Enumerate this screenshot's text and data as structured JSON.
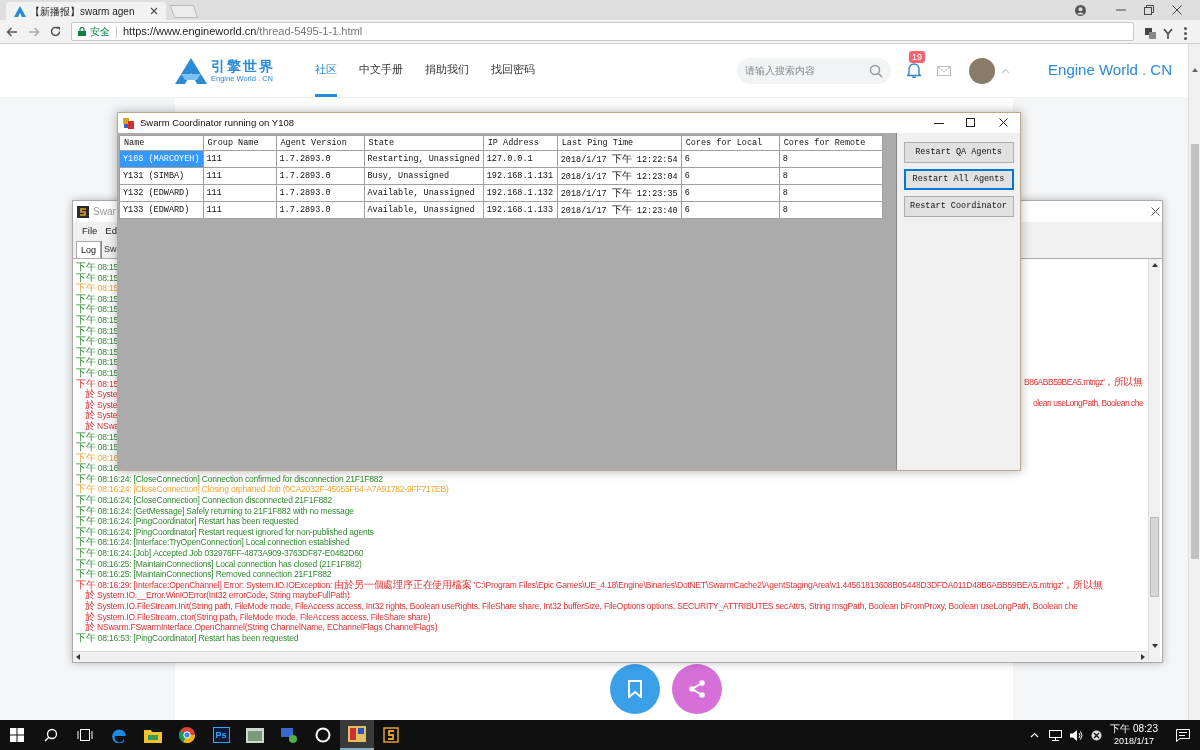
{
  "browser": {
    "tab_title": "【新播报】swarm agen",
    "secure_label": "安全",
    "url_host": "https://www.engineworld.cn",
    "url_path": "/thread-5495-1-1.html"
  },
  "site": {
    "logo_text": "引擎世界",
    "logo_subtitle": "Engine World . CN",
    "nav": [
      {
        "label": "社区",
        "selected": true
      },
      {
        "label": "中文手册",
        "selected": false
      },
      {
        "label": "捐助我们",
        "selected": false
      },
      {
        "label": "找回密码",
        "selected": false
      }
    ],
    "search_placeholder": "请输入搜索内容",
    "notification_count": "19",
    "brand": "Engine World . CN"
  },
  "agent_window": {
    "title": "Swar",
    "menu": [
      "File",
      "Ed"
    ],
    "tabs": [
      {
        "label": "Log",
        "selected": true
      },
      {
        "label": "Sw",
        "selected": false
      }
    ],
    "log": [
      {
        "kind": "info",
        "text": "下午 08:15"
      },
      {
        "kind": "info",
        "text": "下午 08:15"
      },
      {
        "kind": "warn",
        "text": "下午 08:15"
      },
      {
        "kind": "info",
        "text": "下午 08:15"
      },
      {
        "kind": "info",
        "text": "下午 08:15"
      },
      {
        "kind": "info",
        "text": "下午 08:15"
      },
      {
        "kind": "info",
        "text": "下午 08:15"
      },
      {
        "kind": "info",
        "text": "下午 08:15"
      },
      {
        "kind": "info",
        "text": "下午 08:15"
      },
      {
        "kind": "info",
        "text": "下午 08:15"
      },
      {
        "kind": "info",
        "text": "下午 08:15"
      },
      {
        "kind": "error",
        "text": "下午 08:15",
        "tail": "B86ABB59BEA5.mtrigz'，所以無"
      },
      {
        "kind": "stack",
        "text": "於 Syste"
      },
      {
        "kind": "stack",
        "text": "於 Syste",
        "tail": "olean useLongPath, Boolean che"
      },
      {
        "kind": "stack",
        "text": "於 Syste"
      },
      {
        "kind": "stack",
        "text": "於 NSwa"
      },
      {
        "kind": "info",
        "text": "下午 08:15"
      },
      {
        "kind": "info",
        "text": "下午 08:15"
      },
      {
        "kind": "warn",
        "text": "下午 08:16"
      },
      {
        "kind": "info",
        "text": "下午 08:16"
      },
      {
        "kind": "info",
        "text": "下午 08:16:24: [CloseConnection] Connection confirmed for disconnection 21F1F882"
      },
      {
        "kind": "warn",
        "text": "下午 08:16:24: [CloseConnection] Closing orphaned Job (0CA2032F-45055F64-A7A91782-9FF717EB)"
      },
      {
        "kind": "info",
        "text": "下午 08:16:24: [CloseConnection] Connection disconnected 21F1F882"
      },
      {
        "kind": "info",
        "text": "下午 08:16:24: [GetMessage] Safely returning to 21F1F882 with no message"
      },
      {
        "kind": "info",
        "text": "下午 08:16:24: [PingCoordinator] Restart has been requested"
      },
      {
        "kind": "info",
        "text": "下午 08:16:24: [PingCoordinator] Restart request ignored for non-published agents"
      },
      {
        "kind": "info",
        "text": "下午 08:16:24: [Interface:TryOpenConnection] Local connection established"
      },
      {
        "kind": "info",
        "text": "下午 08:16:24: [Job] Accepted Job 032976FF-4873A909-3763DF87-E0482D60"
      },
      {
        "kind": "info",
        "text": "下午 08:16:25: [MaintainConnections] Local connection has closed (21F1F882)"
      },
      {
        "kind": "info",
        "text": "下午 08:16:25: [MaintainConnections] Removed connection 21F1F882"
      },
      {
        "kind": "error",
        "text": "下午 08:16:29: [Interface:OpenChannel] Error: System.IO.IOException: 由於另一個處理序正在使用檔案 'C:\\Program Files\\Epic Games\\UE_4.18\\Engine\\Binaries\\DotNET\\SwarmCache2\\AgentStagingArea\\v1.44561813608B05448D3DFDA011D48B6ABB59BEA5.mtrigz'，所以無"
      },
      {
        "kind": "stack",
        "text": "於 System.IO.__Error.WinIOError(Int32 errorCode, String maybeFullPath)"
      },
      {
        "kind": "stack",
        "text": "於 System.IO.FileStream.Init(String path, FileMode mode, FileAccess access, Int32 rights, Boolean useRights, FileShare share, Int32 bufferSize, FileOptions options, SECURITY_ATTRIBUTES secAttrs, String msgPath, Boolean bFromProxy, Boolean useLongPath, Boolean che"
      },
      {
        "kind": "stack",
        "text": "於 System.IO.FileStream..ctor(String path, FileMode mode, FileAccess access, FileShare share)"
      },
      {
        "kind": "stack",
        "text": "於 NSwarm.FSwarmInterface.OpenChannel(String ChannelName, EChannelFlags ChannelFlags)"
      },
      {
        "kind": "info",
        "text": "下午 08:16:53: [PingCoordinator] Restart has been requested"
      }
    ]
  },
  "coordinator": {
    "title": "Swarm Coordinator running on Y108",
    "columns": [
      "Name",
      "Group Name",
      "Agent Version",
      "State",
      "IP Address",
      "Last Ping Time",
      "Cores for Local",
      "Cores for Remote"
    ],
    "rows": [
      {
        "selected": true,
        "cells": [
          "Y108 (MARCOYEH)",
          "111",
          "1.7.2893.0",
          "Restarting, Unassigned",
          "127.0.0.1",
          "2018/1/17 下午 12:22:54",
          "6",
          "8"
        ]
      },
      {
        "selected": false,
        "cells": [
          "Y131 (SIMBA)",
          "111",
          "1.7.2893.0",
          "Busy, Unassigned",
          "192.168.1.131",
          "2018/1/17 下午 12:23:04",
          "6",
          "8"
        ]
      },
      {
        "selected": false,
        "cells": [
          "Y132 (EDWARD)",
          "111",
          "1.7.2893.0",
          "Available, Unassigned",
          "192.168.1.132",
          "2018/1/17 下午 12:23:35",
          "6",
          "8"
        ]
      },
      {
        "selected": false,
        "cells": [
          "Y133 (EDWARD)",
          "111",
          "1.7.2893.0",
          "Available, Unassigned",
          "192.168.1.133",
          "2018/1/17 下午 12:23:40",
          "6",
          "8"
        ]
      }
    ],
    "buttons": [
      {
        "label": "Restart QA Agents",
        "focused": false
      },
      {
        "label": "Restart All Agents",
        "focused": true
      },
      {
        "label": "Restart Coordinator",
        "focused": false
      }
    ]
  },
  "taskbar": {
    "app_label": "Ps",
    "time": "下午 08:23",
    "date": "2018/1/17"
  }
}
